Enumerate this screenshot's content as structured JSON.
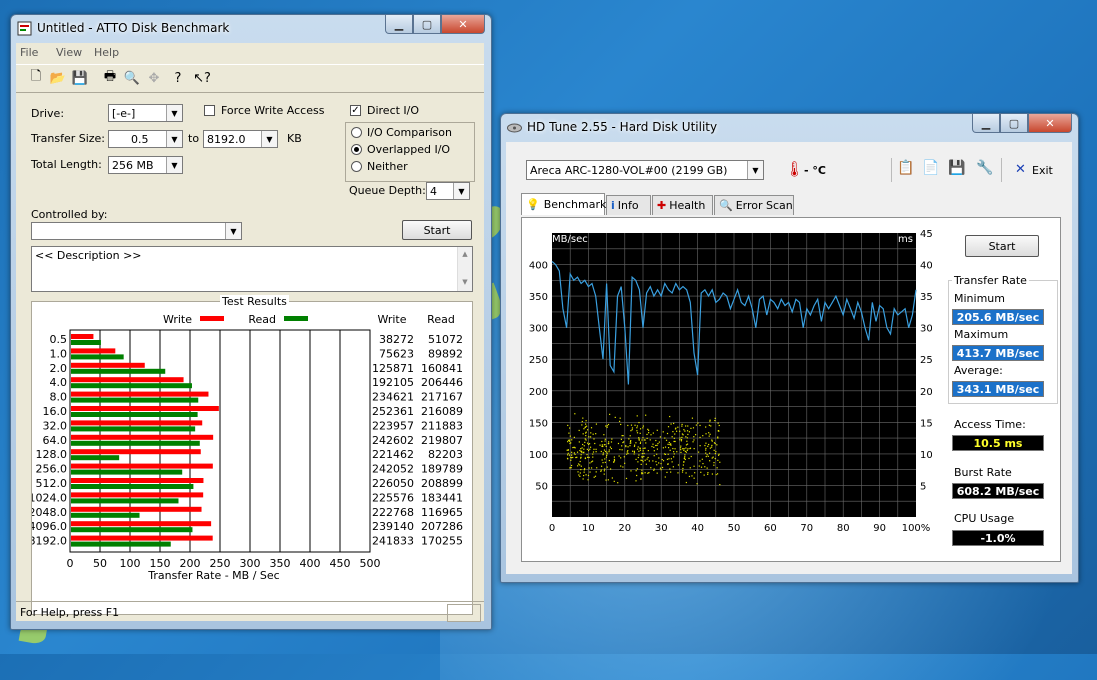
{
  "atto": {
    "title": "Untitled - ATTO Disk Benchmark",
    "menu": [
      "File",
      "View",
      "Help"
    ],
    "toolbar_icons": [
      "new-icon",
      "open-icon",
      "save-icon",
      "print-icon",
      "print-preview-icon",
      "move-icon",
      "help-icon",
      "context-help-icon"
    ],
    "drive_label": "Drive:",
    "drive_value": "[-e-]",
    "force_write_label": "Force Write Access",
    "direct_io_label": "Direct I/O",
    "direct_io_checked": true,
    "transfer_size_label": "Transfer Size:",
    "transfer_from": "0.5",
    "to_label": "to",
    "transfer_to": "8192.0",
    "kb_label": "KB",
    "total_length_label": "Total Length:",
    "total_length_value": "256 MB",
    "io_options": [
      "I/O Comparison",
      "Overlapped I/O",
      "Neither"
    ],
    "io_selected": 1,
    "queue_depth_label": "Queue Depth:",
    "queue_depth_value": "4",
    "controlled_by_label": "Controlled by:",
    "start_label": "Start",
    "description": "<< Description >>",
    "results_title": "Test Results",
    "legend_write": "Write",
    "legend_read": "Read",
    "col_write": "Write",
    "col_read": "Read",
    "axis_ticks": [
      "0",
      "50",
      "100",
      "150",
      "200",
      "250",
      "300",
      "350",
      "400",
      "450",
      "500"
    ],
    "axis_label": "Transfer Rate - MB / Sec",
    "status": "For Help, press F1"
  },
  "chart_data": [
    {
      "type": "bar",
      "orientation": "horizontal",
      "title": "Test Results",
      "xlabel": "Transfer Rate - MB / Sec",
      "xlim": [
        0,
        500
      ],
      "categories": [
        "0.5",
        "1.0",
        "2.0",
        "4.0",
        "8.0",
        "16.0",
        "32.0",
        "64.0",
        "128.0",
        "256.0",
        "512.0",
        "1024.0",
        "2048.0",
        "4096.0",
        "8192.0"
      ],
      "series": [
        {
          "name": "Write",
          "color": "#ff0000",
          "values": [
            38272,
            75623,
            125871,
            192105,
            234621,
            252361,
            223957,
            242602,
            221462,
            242052,
            226050,
            225576,
            222768,
            239140,
            241833
          ]
        },
        {
          "name": "Read",
          "color": "#008000",
          "values": [
            51072,
            89892,
            160841,
            206446,
            217167,
            216089,
            211883,
            219807,
            82203,
            189789,
            208899,
            183441,
            116965,
            207286,
            170255
          ]
        }
      ]
    },
    {
      "type": "line",
      "ylabel": "MB/sec",
      "y2label": "ms",
      "xlim": [
        0,
        100
      ],
      "ylim": [
        0,
        450
      ],
      "y2lim": [
        0,
        45
      ],
      "x_ticks": [
        "0",
        "10",
        "20",
        "30",
        "40",
        "50",
        "60",
        "70",
        "80",
        "90",
        "100%"
      ],
      "y_ticks": [
        "50",
        "100",
        "150",
        "200",
        "250",
        "300",
        "350",
        "400"
      ],
      "y2_ticks": [
        "5",
        "10",
        "15",
        "20",
        "25",
        "30",
        "35",
        "40",
        "45"
      ],
      "series": [
        {
          "name": "Transfer Rate",
          "color": "#3aa0e0",
          "x": [
            0,
            1,
            2,
            3,
            4,
            5,
            6,
            7,
            8,
            9,
            10,
            11,
            12,
            13,
            14,
            15,
            16,
            17,
            18,
            19,
            20,
            21,
            22,
            23,
            24,
            25,
            26,
            27,
            28,
            29,
            30,
            31,
            32,
            33,
            34,
            35,
            36,
            37,
            38,
            39,
            40,
            41,
            42,
            43,
            44,
            45,
            46,
            47,
            48,
            49,
            50,
            51,
            52,
            53,
            54,
            55,
            56,
            57,
            58,
            59,
            60,
            61,
            62,
            63,
            64,
            65,
            66,
            67,
            68,
            69,
            70,
            71,
            72,
            73,
            74,
            75,
            76,
            77,
            78,
            79,
            80,
            81,
            82,
            83,
            84,
            85,
            86,
            87,
            88,
            89,
            90,
            91,
            92,
            93,
            94,
            95,
            96,
            97,
            98,
            99,
            100
          ],
          "y": [
            405,
            400,
            390,
            330,
            300,
            385,
            375,
            380,
            370,
            375,
            365,
            370,
            350,
            300,
            250,
            370,
            240,
            230,
            350,
            365,
            300,
            210,
            380,
            375,
            360,
            300,
            355,
            365,
            350,
            360,
            350,
            370,
            360,
            355,
            370,
            360,
            365,
            360,
            340,
            260,
            225,
            355,
            360,
            350,
            360,
            340,
            345,
            355,
            350,
            330,
            345,
            360,
            340,
            335,
            350,
            330,
            300,
            345,
            350,
            320,
            345,
            340,
            330,
            345,
            335,
            340,
            325,
            345,
            340,
            300,
            330,
            320,
            335,
            345,
            310,
            340,
            330,
            340,
            350,
            335,
            320,
            345,
            330,
            315,
            340,
            325,
            300,
            280,
            340,
            310,
            335,
            330,
            300,
            290,
            330,
            320,
            325,
            330,
            300,
            320,
            360
          ]
        },
        {
          "name": "Access Time",
          "color": "#e6e600",
          "style": "scatter",
          "note_range_ms": [
            5,
            17
          ],
          "x_range": [
            4,
            46
          ]
        }
      ]
    }
  ],
  "hdtune": {
    "title": "HD Tune 2.55 - Hard Disk Utility",
    "drive_combo": "Areca   ARC-1280-VOL#00 (2199 GB)",
    "temp": "- °C",
    "exit_label": "Exit",
    "tabs": [
      "Benchmark",
      "Info",
      "Health",
      "Error Scan"
    ],
    "start_label": "Start",
    "transfer_rate_title": "Transfer Rate",
    "minimum_label": "Minimum",
    "minimum_value": "205.6 MB/sec",
    "maximum_label": "Maximum",
    "maximum_value": "413.7 MB/sec",
    "average_label": "Average:",
    "average_value": "343.1 MB/sec",
    "access_time_label": "Access Time:",
    "access_time_value": "10.5 ms",
    "burst_rate_label": "Burst Rate",
    "burst_rate_value": "608.2 MB/sec",
    "cpu_label": "CPU Usage",
    "cpu_value": "-1.0%"
  }
}
